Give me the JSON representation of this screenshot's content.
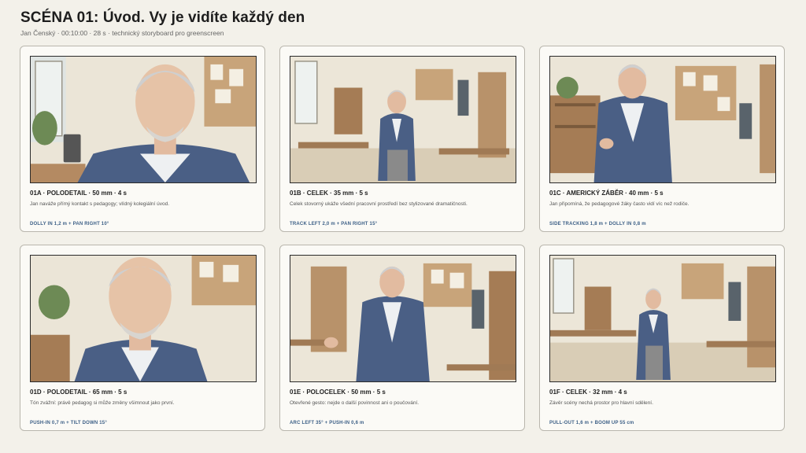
{
  "header": {
    "title": "SCÉNA 01: Úvod. Vy je vidíte každý den",
    "subtitle": "Jan Čenský · 00:10:00 · 28 s · technický storyboard pro greenscreen"
  },
  "panels": [
    {
      "shot": "01A · POLODETAIL · 50 mm · 4 s",
      "desc": "Jan naváže přímý kontakt s pedagogy; vlídný kolegiální úvod.",
      "move": "DOLLY IN 1,2 m + PAN RIGHT 10°"
    },
    {
      "shot": "01B · CELEK · 35 mm · 5 s",
      "desc": "Celek stovorný ukáže všední pracovní prostředí bez stylizované dramatičnosti.",
      "move": "TRACK LEFT 2,0 m + PAN RIGHT 15°"
    },
    {
      "shot": "01C · AMERICKÝ ZÁBĚR · 40 mm · 5 s",
      "desc": "Jan připomíná, že pedagogové žáky často vidí víc než rodiče.",
      "move": "SIDE TRACKING 1,8 m + DOLLY IN 0,8 m"
    },
    {
      "shot": "01D · POLODETAIL · 65 mm · 5 s",
      "desc": "Tón zvážní: právě pedagog si může změny všimnout jako první.",
      "move": "PUSH-IN 0,7 m + TILT DOWN 15°"
    },
    {
      "shot": "01E · POLOCELEK · 50 mm · 5 s",
      "desc": "Otevřené gesto: nejde o další povinnost ani o poučování.",
      "move": "ARC LEFT 35° + PUSH-IN 0,6 m"
    },
    {
      "shot": "01F · CELEK · 32 mm · 4 s",
      "desc": "Závěr scény nechá prostor pro hlavní sdělení.",
      "move": "PULL-OUT 1,6 m + BOOM UP 55 cm"
    }
  ]
}
